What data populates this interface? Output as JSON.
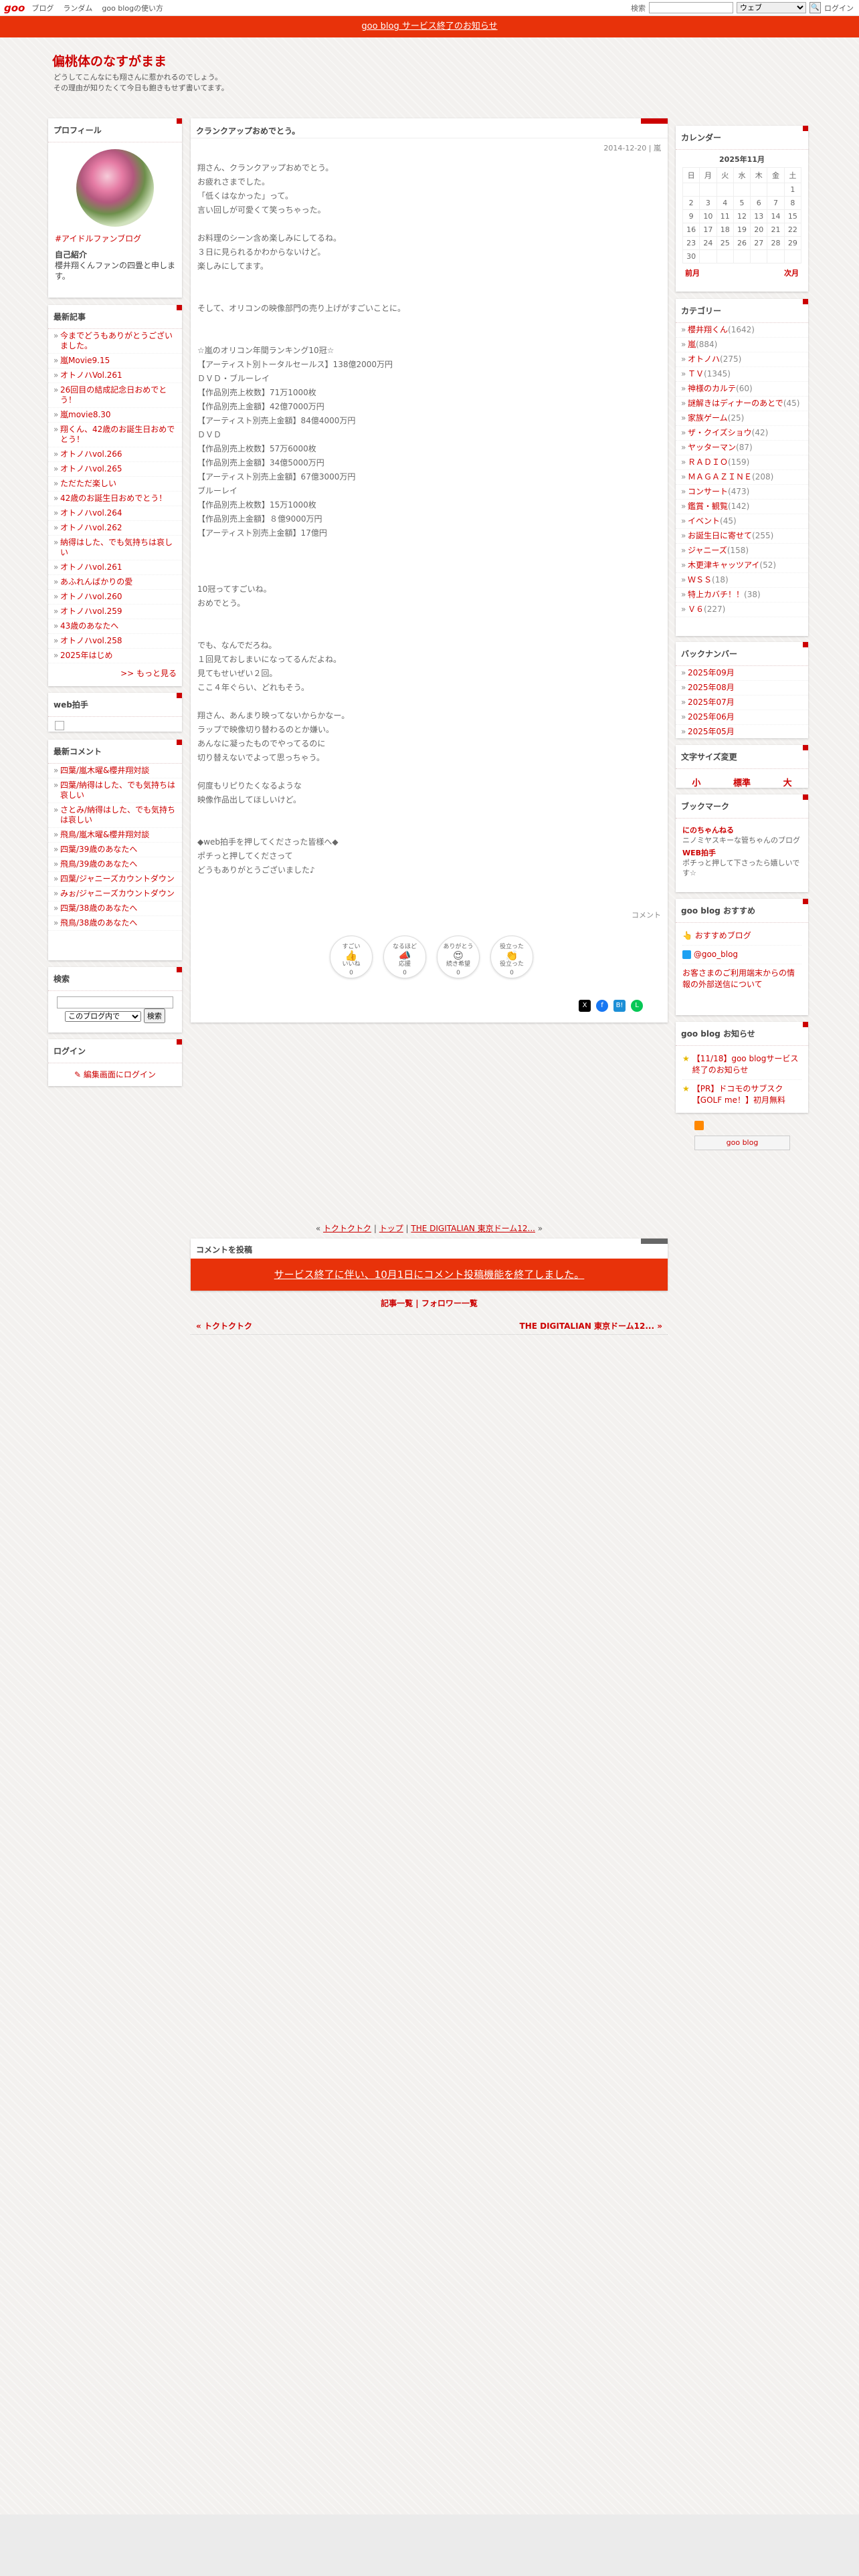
{
  "topbar": {
    "logo": "goo",
    "links": [
      "ブログ",
      "ランダム",
      "goo blogの使い方"
    ],
    "search_label": "検索",
    "search_type": "ウェブ",
    "login": "ログイン"
  },
  "notice": "goo blog サービス終了のお知らせ",
  "blog": {
    "title": "偏桃体のなすがまま",
    "desc1": "どうしてこんなにも翔さんに惹かれるのでしょう。",
    "desc2": "その理由が知りたくて今日も飽きもせず書いてます。"
  },
  "profile": {
    "head": "プロフィール",
    "tag": "#アイドルファンブログ",
    "intro_label": "自己紹介",
    "intro": "櫻井翔くんファンの四畳と申します。"
  },
  "recent": {
    "head": "最新記事",
    "items": [
      "今までどうもありがとうございました。",
      "嵐Movie9.15",
      "オトノハVol.261",
      "26回目の結成記念日おめでとう！",
      "嵐movie8.30",
      "翔くん、42歳のお誕生日おめでとう！",
      "オトノハvol.266",
      "オトノハvol.265",
      "ただただ楽しい",
      "42歳のお誕生日おめでとう！",
      "オトノハvol.264",
      "オトノハvol.262",
      "納得はした、でも気持ちは哀しい",
      "オトノハvol.261",
      "あふれんばかりの愛",
      "オトノハvol.260",
      "オトノハvol.259",
      "43歳のあなたへ",
      "オトノハvol.258",
      "2025年はじめ"
    ],
    "more": ">> もっと見る"
  },
  "webclap": {
    "head": "web拍手"
  },
  "comments": {
    "head": "最新コメント",
    "items": [
      "四葉/嵐木曜&櫻井翔対談",
      "四葉/納得はした、でも気持ちは哀しい",
      "さとみ/納得はした、でも気持ちは哀しい",
      "飛鳥/嵐木曜&櫻井翔対談",
      "四葉/39歳のあなたへ",
      "飛鳥/39歳のあなたへ",
      "四葉/ジャニーズカウントダウン",
      "みぉ/ジャニーズカウントダウン",
      "四葉/38歳のあなたへ",
      "飛鳥/38歳のあなたへ"
    ]
  },
  "search": {
    "head": "検索",
    "scope": "このブログ内で",
    "button": "検索"
  },
  "login": {
    "head": "ログイン",
    "link": "編集画面にログイン"
  },
  "article": {
    "title": "クランクアップおめでとう。",
    "meta": "2014-12-20 | 嵐",
    "body": "翔さん、クランクアップおめでとう。\nお疲れさまでした。\n「低くはなかった」って。\n言い回しが可愛くて笑っちゃった。\n\nお料理のシーン含め楽しみにしてるね。\n３日に見られるかわからないけど。\n楽しみにしてます。\n\n\nそして、オリコンの映像部門の売り上げがすごいことに。\n\n\n☆嵐のオリコン年間ランキング10冠☆\n【アーティスト別トータルセールス】138億2000万円\nＤＶＤ・ブルーレイ\n【作品別売上枚数】71万1000枚\n【作品別売上金額】42億7000万円\n【アーティスト別売上金額】84億4000万円\nＤＶＤ\n【作品別売上枚数】57万6000枚\n【作品別売上金額】34億5000万円\n【アーティスト別売上金額】67億3000万円\nブルーレイ\n【作品別売上枚数】15万1000枚\n【作品別売上金額】８億9000万円\n【アーティスト別売上金額】17億円\n\n\n\n10冠ってすごいね。\nおめでとう。\n\n\nでも、なんでだろね。\n１回見ておしまいになってるんだよね。\n見てもせいぜい２回。\nここ４年ぐらい、どれもそう。\n\n翔さん、あんまり映ってないからかなー。\nラップで映像切り替わるのとか嫌い。\nあんなに凝ったものでやってるのに\n切り替えないでよって思っちゃう。\n\n何度もリピりたくなるような\n映像作品出してほしいけど。\n\n\n◆web拍手を押してくださった皆様へ◆\nポチっと押してくださって\nどうもありがとうございました♪",
    "comment_label": "コメント",
    "reactions": [
      {
        "top": "すごい",
        "icon": "👍",
        "label": "いいね",
        "n": "0"
      },
      {
        "top": "なるほど",
        "icon": "📣",
        "label": "応援",
        "n": "0"
      },
      {
        "top": "ありがとう",
        "icon": "😍",
        "label": "続き希望",
        "n": "0"
      },
      {
        "top": "役立った",
        "icon": "👏",
        "label": "役立った",
        "n": "0"
      }
    ]
  },
  "calendar": {
    "head": "カレンダー",
    "month": "2025年11月",
    "days": [
      "日",
      "月",
      "火",
      "水",
      "木",
      "金",
      "土"
    ],
    "weeks": [
      [
        "",
        "",
        "",
        "",
        "",
        "",
        "1"
      ],
      [
        "2",
        "3",
        "4",
        "5",
        "6",
        "7",
        "8"
      ],
      [
        "9",
        "10",
        "11",
        "12",
        "13",
        "14",
        "15"
      ],
      [
        "16",
        "17",
        "18",
        "19",
        "20",
        "21",
        "22"
      ],
      [
        "23",
        "24",
        "25",
        "26",
        "27",
        "28",
        "29"
      ],
      [
        "30",
        "",
        "",
        "",
        "",
        "",
        ""
      ]
    ],
    "prev": "前月",
    "next": "次月"
  },
  "category": {
    "head": "カテゴリー",
    "items": [
      [
        "櫻井翔くん",
        "(1642)"
      ],
      [
        "嵐",
        "(884)"
      ],
      [
        "オトノハ",
        "(275)"
      ],
      [
        "ＴＶ",
        "(1345)"
      ],
      [
        "神様のカルテ",
        "(60)"
      ],
      [
        "謎解きはディナーのあとで",
        "(45)"
      ],
      [
        "家族ゲーム",
        "(25)"
      ],
      [
        "ザ・クイズショウ",
        "(42)"
      ],
      [
        "ヤッターマン",
        "(87)"
      ],
      [
        "ＲＡＤＩＯ",
        "(159)"
      ],
      [
        "ＭＡＧＡＺＩＮＥ",
        "(208)"
      ],
      [
        "コンサート",
        "(473)"
      ],
      [
        "鑑賞・観覧",
        "(142)"
      ],
      [
        "イベント",
        "(45)"
      ],
      [
        "お誕生日に寄せて",
        "(255)"
      ],
      [
        "ジャニーズ",
        "(158)"
      ],
      [
        "木更津キャッツアイ",
        "(52)"
      ],
      [
        "ＷＳＳ",
        "(18)"
      ],
      [
        "特上カバチ！！",
        "(38)"
      ],
      [
        "Ｖ６",
        "(227)"
      ]
    ]
  },
  "backnumber": {
    "head": "バックナンバー",
    "items": [
      "2025年09月",
      "2025年08月",
      "2025年07月",
      "2025年06月",
      "2025年05月"
    ]
  },
  "fontsize": {
    "head": "文字サイズ変更",
    "small": "小",
    "normal": "標準",
    "large": "大"
  },
  "bookmark": {
    "head": "ブックマーク",
    "b1": "にのちゃんねる",
    "d1": "ニノミヤスキーな管ちゃんのブログ",
    "b2": "WEB拍手",
    "d2": "ポチっと押して下さったら嬉しいです☆"
  },
  "goo_rec": {
    "head": "goo blog おすすめ",
    "i1": "おすすめブログ",
    "i2": "@goo_blog",
    "i3": "お客さまのご利用端末からの情報の外部送信について"
  },
  "goo_news": {
    "head": "goo blog お知らせ",
    "n1": "【11/18】goo blogサービス終了のお知らせ",
    "n2": "【PR】ドコモのサブスク【GOLF me！】初月無料"
  },
  "footer_logo": "goo blog",
  "pnav": {
    "prev": "トクトクトク",
    "top": "トップ",
    "next": "THE DIGITALIAN 東京ドーム12..."
  },
  "comment_post": {
    "head": "コメントを投稿",
    "end": "サービス終了に伴い、10月1日にコメント投稿機能を終了しました。"
  },
  "post_links": {
    "l1": "記事一覧",
    "l2": "フォロワー一覧"
  },
  "pn": {
    "prev": "トクトクトク",
    "next": "THE DIGITALIAN 東京ドーム12..."
  }
}
